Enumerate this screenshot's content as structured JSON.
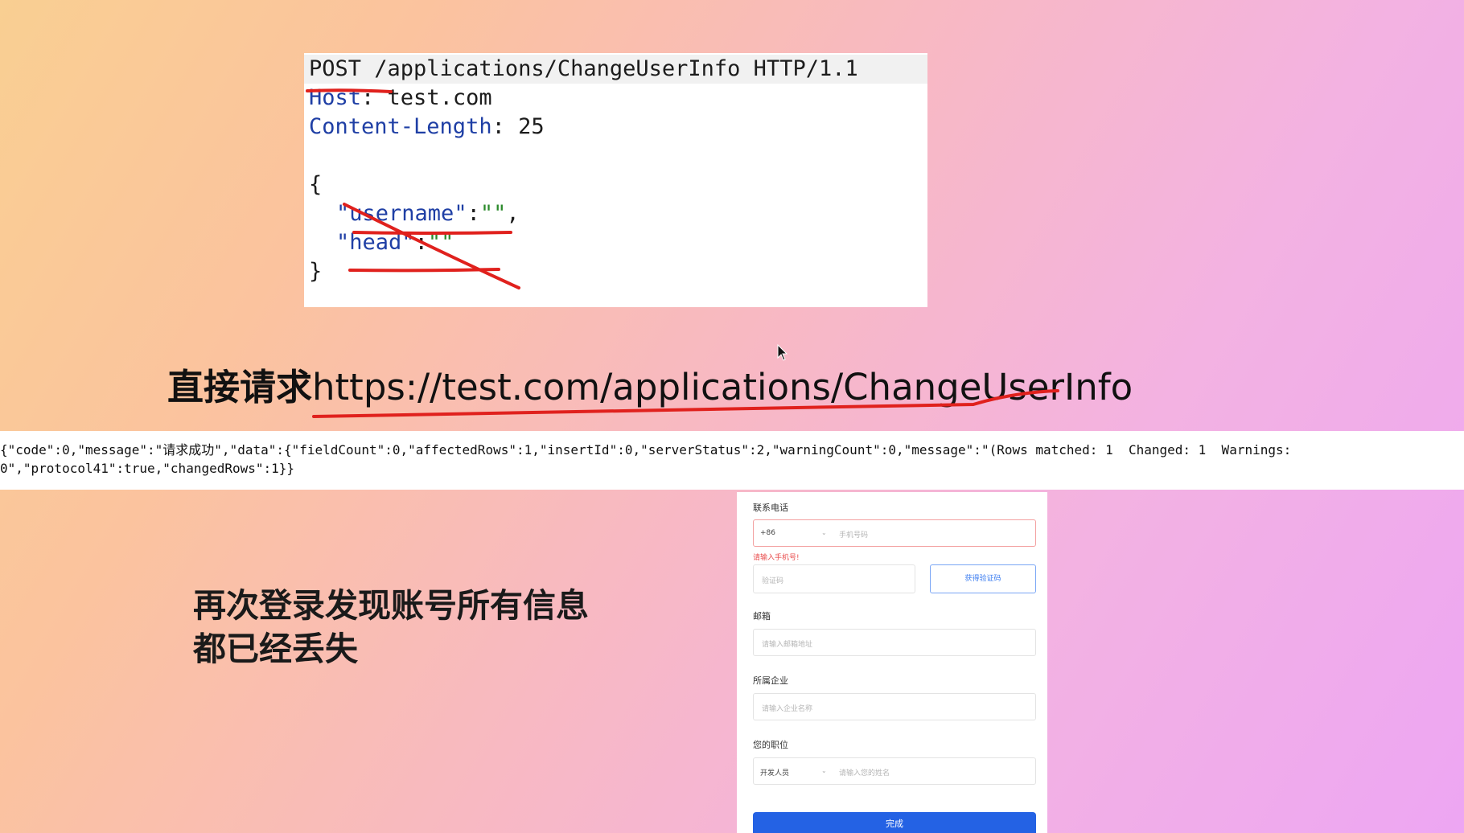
{
  "code": {
    "request_line": "POST /applications/ChangeUserInfo HTTP/1.1",
    "host_key": "Host",
    "host_value": "test.com",
    "length_key": "Content-Length",
    "length_value": "25",
    "open_brace": "{",
    "field_username": "username",
    "field_head": "head",
    "close_brace": "}"
  },
  "headline": {
    "prefix": "直接请求",
    "url": "https://test.com/applications/ChangeUserInfo"
  },
  "response": {
    "line1": "{\"code\":0,\"message\":\"请求成功\",\"data\":{\"fieldCount\":0,\"affectedRows\":1,\"insertId\":0,\"serverStatus\":2,\"warningCount\":0,\"message\":\"(Rows matched: 1  Changed: 1  Warnings:",
    "line2": "0\",\"protocol41\":true,\"changedRows\":1}}"
  },
  "caption": {
    "line1": "再次登录发现账号所有信息",
    "line2": "都已经丢失"
  },
  "form": {
    "phone_label": "联系电话",
    "phone_prefix": "+86",
    "phone_placeholder": "手机号码",
    "phone_error": "请输入手机号!",
    "code_placeholder": "验证码",
    "get_code_label": "获得验证码",
    "email_label": "邮箱",
    "email_placeholder": "请输入邮箱地址",
    "company_label": "所属企业",
    "company_placeholder": "请输入企业名称",
    "position_label": "您的职位",
    "position_value": "开发人员",
    "position_placeholder": "请输入您的姓名",
    "submit_label": "完成"
  },
  "colors": {
    "annotation": "#e0211d",
    "submit": "#2462e4",
    "error": "#e94e4e"
  }
}
